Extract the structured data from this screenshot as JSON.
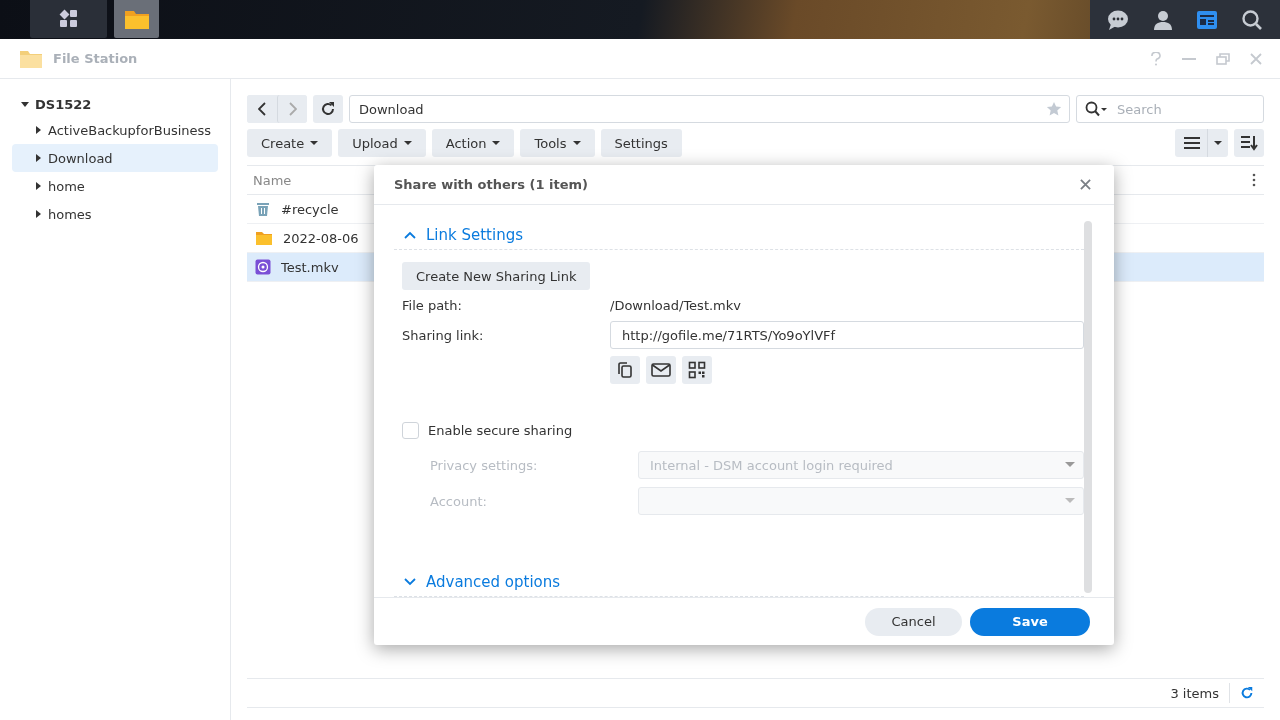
{
  "taskbar": {
    "apps": [
      {
        "kind": "main-menu",
        "selected": false
      },
      {
        "kind": "file-station",
        "selected": true
      }
    ]
  },
  "window": {
    "title": "File Station"
  },
  "sidebar": {
    "root": {
      "label": "DS1522",
      "expanded": true,
      "children": [
        {
          "label": "ActiveBackupforBusiness",
          "selected": false,
          "expanded": false
        },
        {
          "label": "Download",
          "selected": true,
          "expanded": false
        },
        {
          "label": "home",
          "selected": false,
          "expanded": false
        },
        {
          "label": "homes",
          "selected": false,
          "expanded": false
        }
      ]
    }
  },
  "navigation": {
    "path": "Download",
    "search": {
      "placeholder": "Search"
    }
  },
  "toolbar": [
    {
      "label": "Create",
      "dropdown": true
    },
    {
      "label": "Upload",
      "dropdown": true
    },
    {
      "label": "Action",
      "dropdown": true
    },
    {
      "label": "Tools",
      "dropdown": true
    },
    {
      "label": "Settings",
      "dropdown": false
    }
  ],
  "file_list": {
    "columns": [
      "Name"
    ],
    "rows": [
      {
        "name": "#recycle",
        "kind": "recycle",
        "selected": false
      },
      {
        "name": "2022-08-06",
        "kind": "folder",
        "selected": false
      },
      {
        "name": "Test.mkv",
        "kind": "video",
        "selected": true
      }
    ]
  },
  "status_bar": {
    "count": "3 items"
  },
  "dialog": {
    "title": "Share with others (1 item)",
    "link_settings": {
      "label": "Link Settings",
      "expanded": true
    },
    "create_link_button": "Create New Sharing Link",
    "file_path": {
      "label": "File path:",
      "value": "/Download/Test.mkv"
    },
    "sharing_link": {
      "label": "Sharing link:",
      "value": "http://gofile.me/71RTS/Yo9oYlVFf"
    },
    "secure_sharing": {
      "label": "Enable secure sharing",
      "checked": false
    },
    "privacy": {
      "label": "Privacy settings:",
      "value": "Internal - DSM account login required",
      "disabled": true
    },
    "account": {
      "label": "Account:",
      "disabled": true
    },
    "advanced": {
      "label": "Advanced options",
      "expanded": false
    },
    "buttons": {
      "cancel": "Cancel",
      "save": "Save"
    }
  }
}
